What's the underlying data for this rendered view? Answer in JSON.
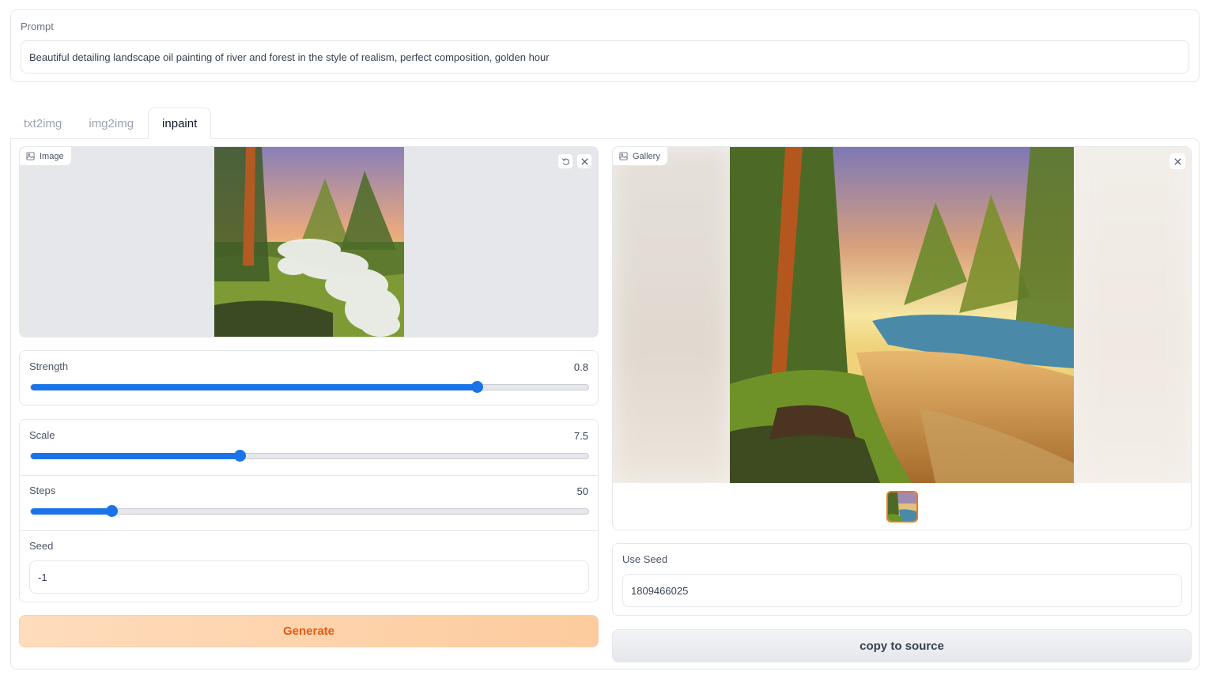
{
  "prompt": {
    "label": "Prompt",
    "value": "Beautiful detailing landscape oil painting of river and forest in the style of realism, perfect composition, golden hour"
  },
  "tabs": [
    {
      "label": "txt2img",
      "active": false
    },
    {
      "label": "img2img",
      "active": false
    },
    {
      "label": "inpaint",
      "active": true
    }
  ],
  "image_panel": {
    "badge": "Image",
    "icons": {
      "badge": "image-icon",
      "undo": "undo-icon",
      "clear": "close-icon"
    }
  },
  "strength": {
    "label": "Strength",
    "value": "0.8",
    "min": 0,
    "max": 1,
    "fraction": 0.8
  },
  "scale": {
    "label": "Scale",
    "value": "7.5",
    "min": 0,
    "max": 20,
    "fraction": 0.375
  },
  "steps": {
    "label": "Steps",
    "value": "50",
    "min": 0,
    "max": 350,
    "fraction": 0.145
  },
  "seed": {
    "label": "Seed",
    "value": "-1"
  },
  "generate": {
    "label": "Generate"
  },
  "gallery": {
    "badge": "Gallery",
    "icons": {
      "badge": "image-icon",
      "clear": "close-icon"
    }
  },
  "use_seed": {
    "label": "Use Seed",
    "value": "1809466025"
  },
  "copy_to_source": {
    "label": "copy to source"
  },
  "colors": {
    "accent": "#1a73e8",
    "generate_text": "#ea580c",
    "selected_border": "#f97316"
  }
}
